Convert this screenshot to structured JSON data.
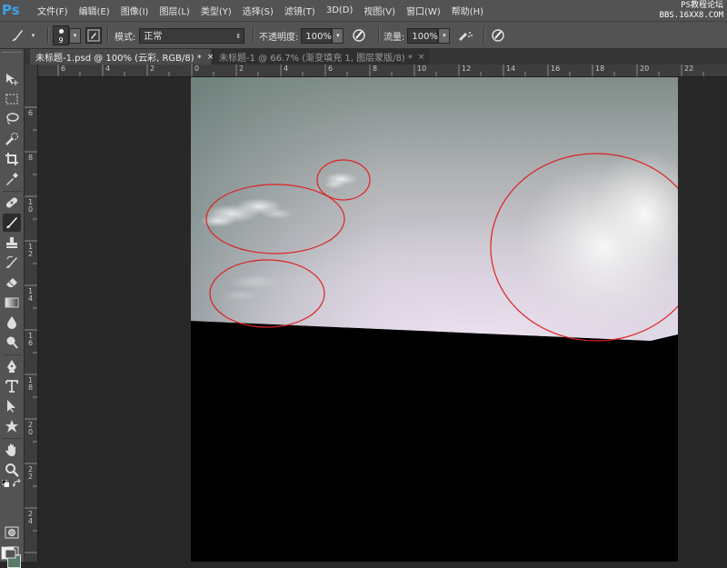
{
  "app": {
    "logo": "Ps"
  },
  "menu": [
    "文件(F)",
    "编辑(E)",
    "图像(I)",
    "图层(L)",
    "类型(Y)",
    "选择(S)",
    "滤镜(T)",
    "3D(D)",
    "视图(V)",
    "窗口(W)",
    "帮助(H)"
  ],
  "watermark": {
    "line1": "PS教程论坛",
    "line2": "BBS.16XX8.COM"
  },
  "options": {
    "brush_size": "9",
    "mode_label": "模式:",
    "mode_value": "正常",
    "opacity_label": "不透明度:",
    "opacity_value": "100%",
    "flow_label": "流量:",
    "flow_value": "100%"
  },
  "tabs": [
    {
      "label": "未标题-1.psd @ 100% (云彩, RGB/8) *",
      "close": "×",
      "active": true
    },
    {
      "label": "未标题-1 @ 66.7% (渐变填充 1, 图层蒙版/8) *",
      "close": "×",
      "active": false
    }
  ],
  "ruler": {
    "h_labels": [
      "6",
      "4",
      "2",
      "0",
      "2",
      "4",
      "6",
      "8",
      "10",
      "12",
      "14",
      "16",
      "18",
      "20",
      "22"
    ],
    "v_labels": [
      "6",
      "8",
      "10",
      "12",
      "14",
      "16",
      "18",
      "20",
      "22",
      "24"
    ]
  },
  "colors": {
    "foreground": "#f4eef6",
    "background": "#587a68",
    "accent_ps": "#3fa3e8",
    "circle": "#dd2222"
  },
  "canvas": {
    "document": "未标题-1.psd",
    "zoom": "100%",
    "layer": "云彩",
    "annotations": [
      {
        "name": "small-cloud-circle"
      },
      {
        "name": "large-cloud-circle"
      },
      {
        "name": "lower-cloud-circle"
      },
      {
        "name": "bright-glow-circle"
      }
    ]
  }
}
